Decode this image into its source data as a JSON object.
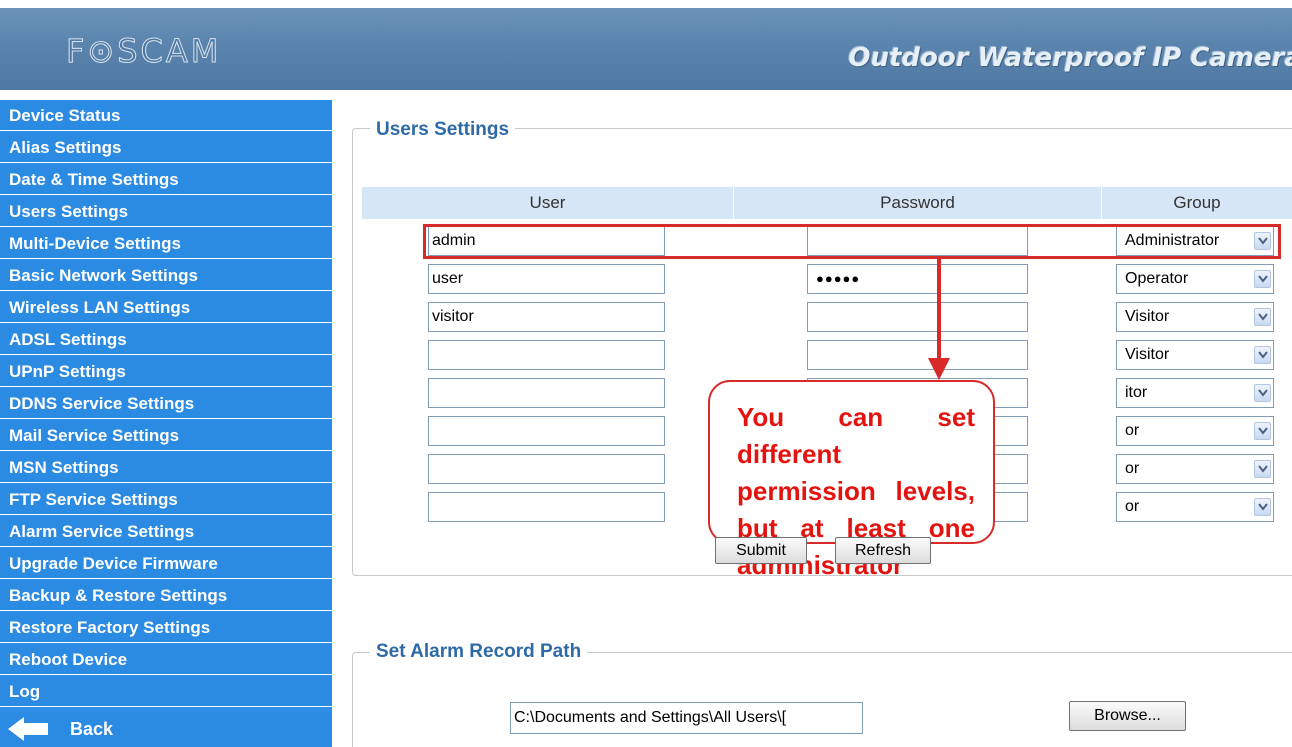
{
  "header": {
    "logo": "F⊙SCAM",
    "tagline": "Outdoor Waterproof IP Camera"
  },
  "sidebar": {
    "items": [
      {
        "label": "Device Status"
      },
      {
        "label": "Alias Settings"
      },
      {
        "label": "Date & Time Settings"
      },
      {
        "label": "Users Settings"
      },
      {
        "label": "Multi-Device Settings"
      },
      {
        "label": "Basic Network Settings"
      },
      {
        "label": "Wireless LAN Settings"
      },
      {
        "label": "ADSL Settings"
      },
      {
        "label": "UPnP Settings"
      },
      {
        "label": "DDNS Service Settings"
      },
      {
        "label": "Mail Service Settings"
      },
      {
        "label": "MSN Settings"
      },
      {
        "label": "FTP Service Settings"
      },
      {
        "label": "Alarm Service Settings"
      },
      {
        "label": "Upgrade Device Firmware"
      },
      {
        "label": "Backup & Restore Settings"
      },
      {
        "label": "Restore Factory Settings"
      },
      {
        "label": "Reboot Device"
      },
      {
        "label": "Log"
      }
    ],
    "back_label": "Back"
  },
  "users": {
    "legend": "Users Settings",
    "columns": {
      "user": "User",
      "password": "Password",
      "group": "Group"
    },
    "rows": [
      {
        "user": "admin",
        "password": "",
        "group": "Administrator"
      },
      {
        "user": "user",
        "password": "●●●●●",
        "group": "Operator"
      },
      {
        "user": "visitor",
        "password": "",
        "group": "Visitor"
      },
      {
        "user": "",
        "password": "",
        "group": "Visitor"
      },
      {
        "user": "",
        "password": "",
        "group": "itor"
      },
      {
        "user": "",
        "password": "",
        "group": "or"
      },
      {
        "user": "",
        "password": "",
        "group": "or"
      },
      {
        "user": "",
        "password": "",
        "group": "or"
      }
    ],
    "submit_label": "Submit",
    "refresh_label": "Refresh"
  },
  "annotation": {
    "text": "You can set different permission levels, but at least one administrator",
    "color": "#d92a2a"
  },
  "alarm": {
    "legend": "Set Alarm Record Path",
    "path_value": "C:\\Documents and Settings\\All Users\\[",
    "browse_label": "Browse..."
  }
}
